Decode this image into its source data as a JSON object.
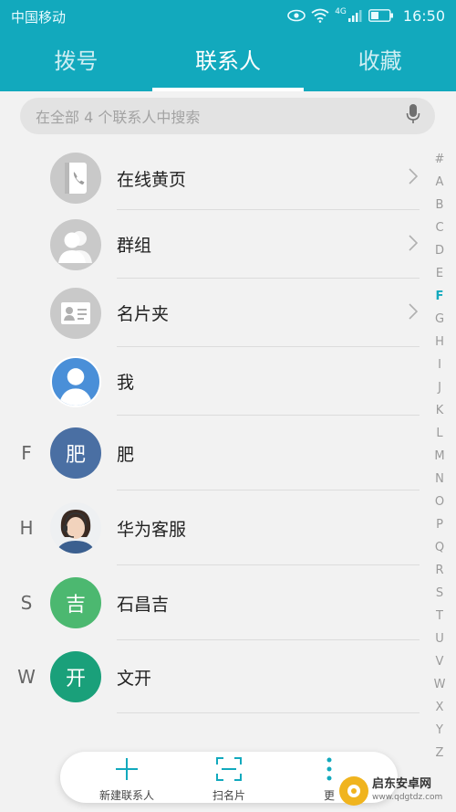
{
  "status_bar": {
    "carrier": "中国移动",
    "network_badge": "4G",
    "time": "16:50",
    "icons": [
      "eye-icon",
      "wifi-icon",
      "signal-icon",
      "battery-icon"
    ]
  },
  "tabs": [
    {
      "label": "拨号",
      "active": false
    },
    {
      "label": "联系人",
      "active": true
    },
    {
      "label": "收藏",
      "active": false
    }
  ],
  "search": {
    "placeholder": "在全部 4 个联系人中搜索",
    "icon": "mic-icon"
  },
  "contacts": [
    {
      "name": "在线黄页",
      "icon": "yellow-pages-icon",
      "has_chevron": true
    },
    {
      "name": "群组",
      "icon": "group-icon",
      "has_chevron": true
    },
    {
      "name": "名片夹",
      "icon": "business-card-icon",
      "has_chevron": true
    },
    {
      "name": "我",
      "icon": "profile-icon",
      "has_chevron": false
    },
    {
      "section": "F",
      "name": "肥",
      "avatar_text": "肥",
      "color": "#4a6fa3"
    },
    {
      "section": "H",
      "name": "华为客服",
      "avatar": "photo",
      "icon": "agent-photo-icon"
    },
    {
      "section": "S",
      "name": "石昌吉",
      "avatar_text": "吉",
      "color": "#4cb870"
    },
    {
      "section": "W",
      "name": "文开",
      "avatar_text": "开",
      "color": "#1aa07a"
    }
  ],
  "alphabet_index": [
    "#",
    "A",
    "B",
    "C",
    "D",
    "E",
    "F",
    "G",
    "H",
    "I",
    "J",
    "K",
    "L",
    "M",
    "N",
    "O",
    "P",
    "Q",
    "R",
    "S",
    "T",
    "U",
    "V",
    "W",
    "X",
    "Y",
    "Z"
  ],
  "alphabet_active": "F",
  "bottom_bar": {
    "add_label": "新建联系人",
    "scan_label": "扫名片",
    "more_label": "更"
  },
  "watermark": {
    "title": "启东安卓网",
    "url": "www.qdgtdz.com"
  },
  "colors": {
    "header": "#12a9bd",
    "accent": "#12a9bd",
    "background": "#f2f2f2"
  }
}
